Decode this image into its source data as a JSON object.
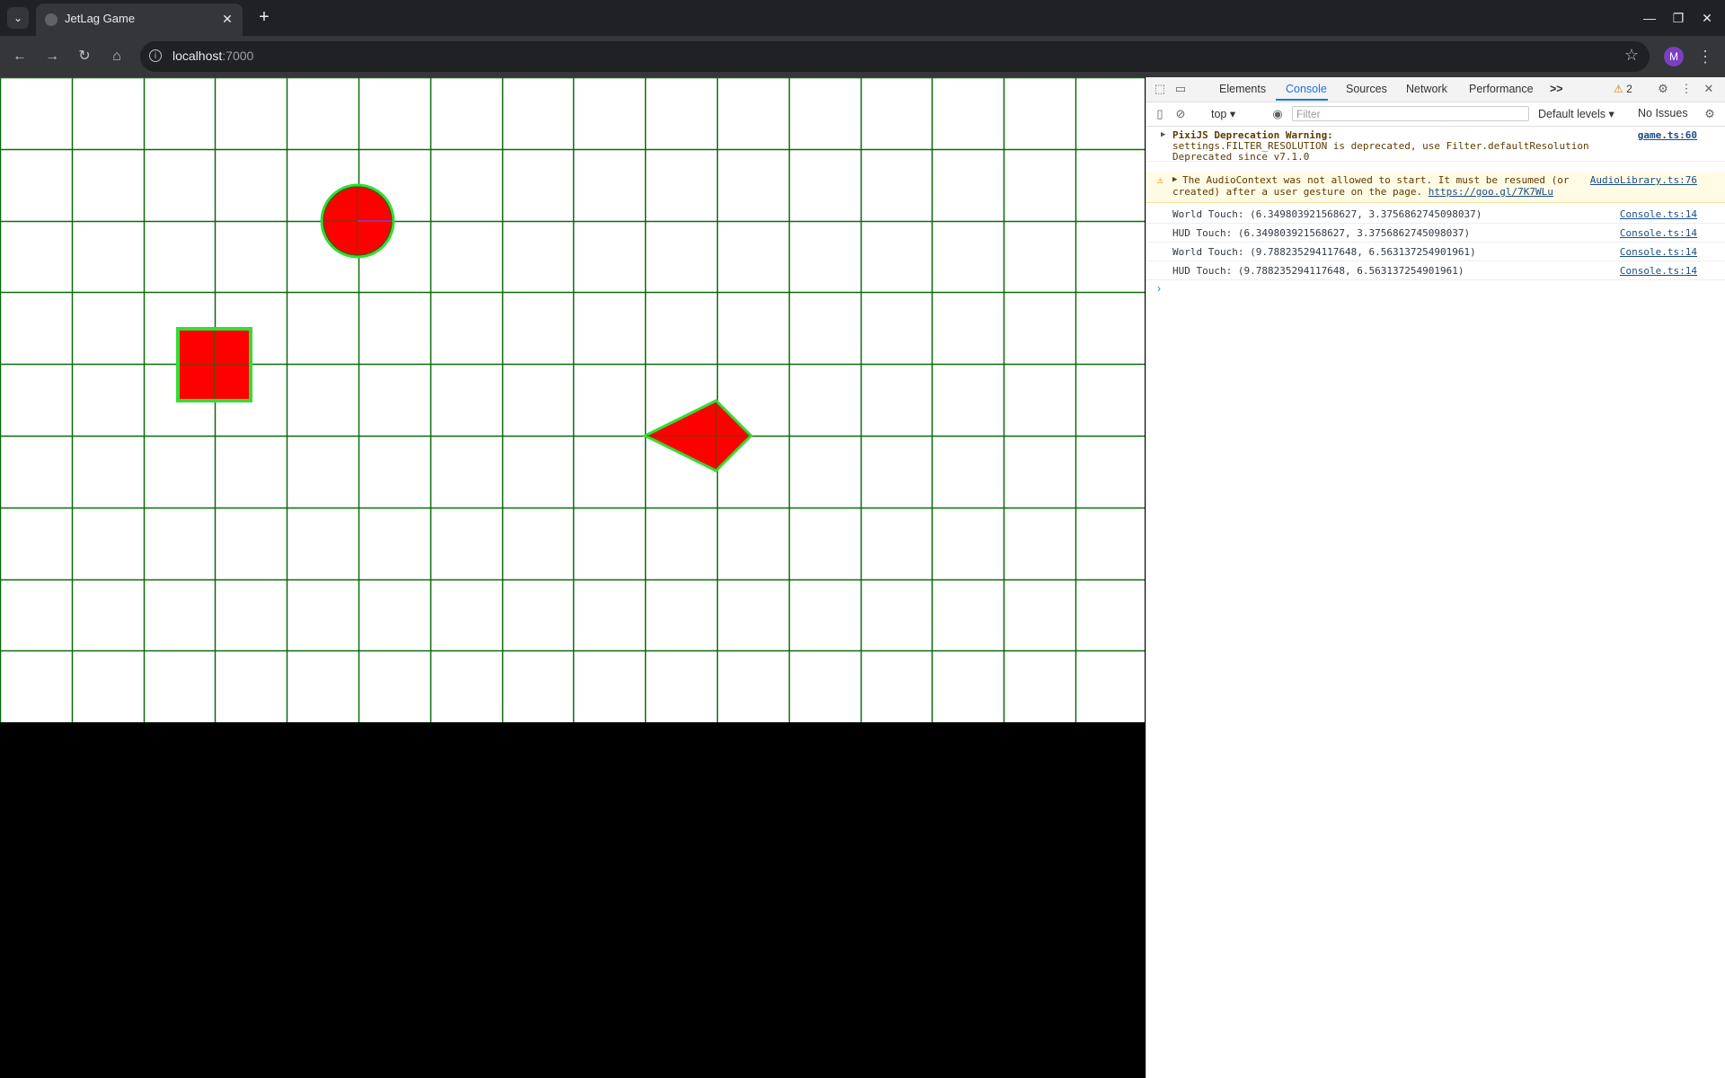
{
  "browser": {
    "tab_title": "JetLag Game",
    "url_host": "localhost",
    "url_port": ":7000",
    "avatar_initial": "M"
  },
  "game": {
    "background": "#ffffff",
    "grid_color": "#0a6b0a",
    "shape_fill": "#ff0000",
    "shape_outline": "#33dd33",
    "grid_columns": 16,
    "grid_rows": 9
  },
  "devtools": {
    "tabs": [
      "Elements",
      "Console",
      "Sources",
      "Network",
      "Performance"
    ],
    "more_tabs": ">>",
    "warning_count": "2",
    "context": "top",
    "filter_placeholder": "Filter",
    "levels": "Default levels",
    "issues": "No Issues",
    "messages": [
      {
        "type": "warn-collapsed",
        "line1": "PixiJS Deprecation Warning:",
        "line2": "settings.FILTER_RESOLUTION is deprecated, use Filter.defaultResolution",
        "line3": "Deprecated since v7.1.0",
        "source": "game.ts:60"
      },
      {
        "type": "warn",
        "line1": "The AudioContext was not allowed to start. It must be resumed (or",
        "line2": "created) after a user gesture on the page.",
        "link": "https://goo.gl/7K7WLu",
        "source": "AudioLibrary.ts:76"
      },
      {
        "type": "log",
        "text": "World Touch: (6.349803921568627, 3.3756862745098037)",
        "source": "Console.ts:14"
      },
      {
        "type": "log",
        "text": "HUD Touch: (6.349803921568627, 3.3756862745098037)",
        "source": "Console.ts:14"
      },
      {
        "type": "log",
        "text": "World Touch: (9.788235294117648, 6.563137254901961)",
        "source": "Console.ts:14"
      },
      {
        "type": "log",
        "text": "HUD Touch: (9.788235294117648, 6.563137254901961)",
        "source": "Console.ts:14"
      }
    ],
    "prompt": "›"
  },
  "icons": {
    "tab_list": "⌄",
    "close": "✕",
    "new_tab": "+",
    "minimize": "—",
    "maximize": "❐",
    "back": "←",
    "forward": "→",
    "reload": "↻",
    "home": "⌂",
    "info": "i",
    "bookmark": "☆",
    "menu": "⋮",
    "inspect": "⬚",
    "device": "▭",
    "settings": "⚙",
    "sidebar": "▯",
    "clear": "⊘",
    "eye": "◉",
    "gear": "⚙",
    "dropdown": "▾",
    "expand": "▶",
    "warning": "⚠"
  }
}
